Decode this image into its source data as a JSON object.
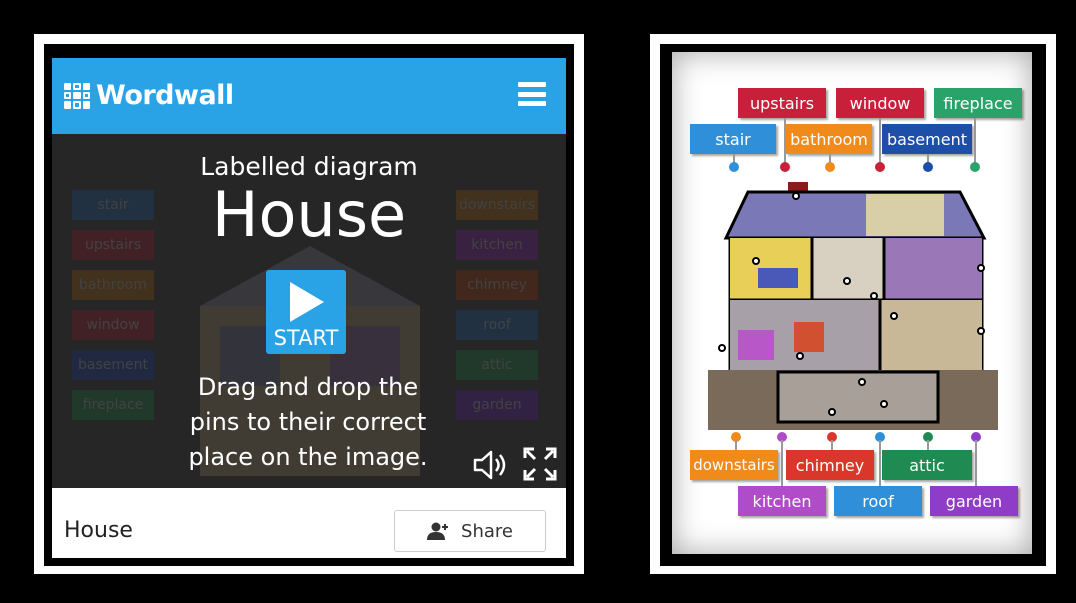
{
  "wordwall": {
    "logo_text": "Wordwall",
    "subtitle": "Labelled diagram",
    "title": "House",
    "start_label": "START",
    "instructions": "Drag and drop the pins to their correct place on the image.",
    "footer_title": "House",
    "share_label": "Share",
    "icons": {
      "menu": "hamburger-menu-icon",
      "sound": "speaker-icon",
      "fullscreen": "fullscreen-icon",
      "share": "person-icon"
    },
    "ghost_labels_left": [
      "stair",
      "upstairs",
      "bathroom",
      "window",
      "basement",
      "fireplace"
    ],
    "ghost_labels_right": [
      "downstairs",
      "kitchen",
      "chimney",
      "roof",
      "attic",
      "garden"
    ]
  },
  "diagram": {
    "top_row1": [
      {
        "text": "upstairs",
        "color": "#c8203a"
      },
      {
        "text": "window",
        "color": "#c8203a"
      },
      {
        "text": "fireplace",
        "color": "#2aa36b"
      }
    ],
    "top_row2": [
      {
        "text": "stair",
        "color": "#2f8fd8"
      },
      {
        "text": "bathroom",
        "color": "#f08a1a"
      },
      {
        "text": "basement",
        "color": "#1e4fa8"
      }
    ],
    "bottom_row1": [
      {
        "text": "downstairs",
        "color": "#f08a1a"
      },
      {
        "text": "chimney",
        "color": "#d8372a"
      },
      {
        "text": "attic",
        "color": "#1f8a52"
      }
    ],
    "bottom_row2": [
      {
        "text": "kitchen",
        "color": "#b14cc8"
      },
      {
        "text": "roof",
        "color": "#2f8fd8"
      },
      {
        "text": "garden",
        "color": "#8f3cc8"
      }
    ]
  },
  "colors": {
    "wordwall_blue": "#29a3e6",
    "stage_bg": "#262626"
  }
}
